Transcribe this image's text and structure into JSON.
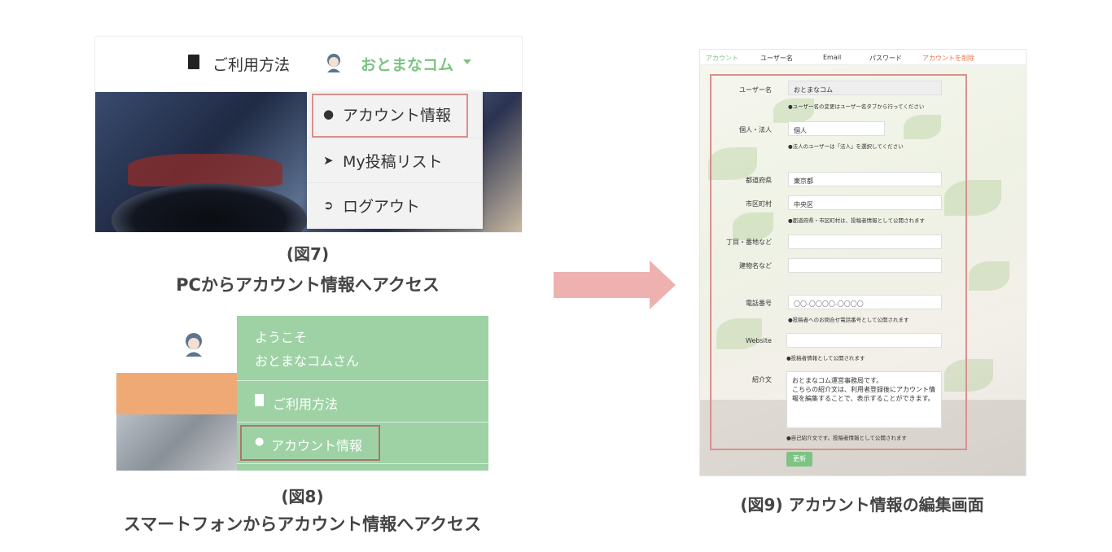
{
  "fig7": {
    "nav_help": "ご利用方法",
    "nav_user": "おとまなコム",
    "menu": [
      {
        "label": "アカウント情報",
        "icon": "user-icon"
      },
      {
        "label": "My投稿リスト",
        "icon": "paper-plane-icon"
      },
      {
        "label": "ログアウト",
        "icon": "logout-icon"
      }
    ],
    "caption_num": "(図7)",
    "caption": "PCからアカウント情報へアクセス"
  },
  "fig8": {
    "welcome": "ようこそ",
    "user_greeting": "おとまなコムさん",
    "help": "ご利用方法",
    "account": "アカウント情報",
    "caption_num": "(図8)",
    "caption": "スマートフォンからアカウント情報へアクセス"
  },
  "fig9": {
    "tabs": [
      "アカウント",
      "ユーザー名",
      "Email",
      "パスワード",
      "アカウントを削除"
    ],
    "fields": {
      "username_label": "ユーザー名",
      "username_value": "おとまなコム",
      "username_hint": "●ユーザー名の変更はユーザー名タブから行ってください",
      "type_label": "個人・法人",
      "type_value": "個人",
      "type_hint": "●法人のユーザーは「法人」を選択してください",
      "pref_label": "都道府県",
      "pref_value": "東京都",
      "city_label": "市区町村",
      "city_value": "中央区",
      "city_hint": "●都道府県・市区町村は、投稿者情報として公開されます",
      "street_label": "丁目・番地など",
      "building_label": "建物名など",
      "phone_label": "電話番号",
      "phone_placeholder": "〇〇-〇〇〇〇-〇〇〇〇",
      "phone_hint": "●投稿者へのお問合せ電話番号として公開されます",
      "website_label": "Website",
      "website_hint": "●投稿者情報として公開されます",
      "intro_label": "紹介文",
      "intro_value": "おとまなコム運営事務局です。\nこちらの紹介文は、利用者登録後にアカウント情報を編集することで、表示することができます。",
      "intro_hint": "●自己紹介文です。投稿者情報として公開されます"
    },
    "submit": "更新",
    "caption": "(図9) アカウント情報の編集画面"
  },
  "colors": {
    "accent_green": "#7dc383",
    "highlight_red": "#d9908c",
    "arrow_pink": "#eeb1b0",
    "tab_orange": "#e8754b"
  }
}
